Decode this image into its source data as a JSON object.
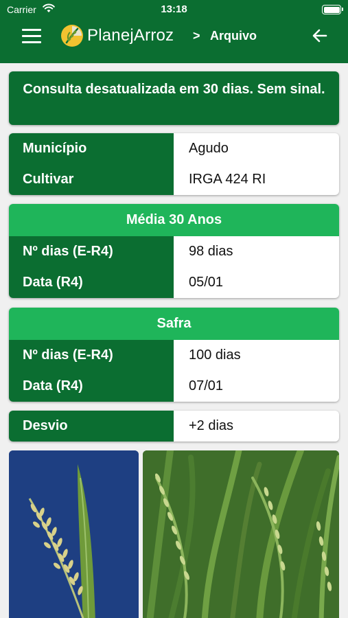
{
  "status_bar": {
    "carrier": "Carrier",
    "time": "13:18"
  },
  "nav": {
    "brand": "PlanejArroz",
    "separator": ">",
    "crumb": "Arquivo"
  },
  "alert": {
    "message": "Consulta desatualizada em 30 dias. Sem sinal."
  },
  "info": {
    "rows": [
      {
        "label": "Município",
        "value": "Agudo"
      },
      {
        "label": "Cultivar",
        "value": "IRGA 424 RI"
      }
    ]
  },
  "media": {
    "title": "Média 30 Anos",
    "rows": [
      {
        "label": "Nº dias (E-R4)",
        "value": "98 dias"
      },
      {
        "label": "Data (R4)",
        "value": "05/01"
      }
    ]
  },
  "safra": {
    "title": "Safra",
    "rows": [
      {
        "label": "Nº dias (E-R4)",
        "value": "100 dias"
      },
      {
        "label": "Data (R4)",
        "value": "07/01"
      }
    ]
  },
  "desvio": {
    "label": "Desvio",
    "value": "+2 dias"
  },
  "colors": {
    "primary": "#0b6e31",
    "accent": "#1fb55a"
  }
}
